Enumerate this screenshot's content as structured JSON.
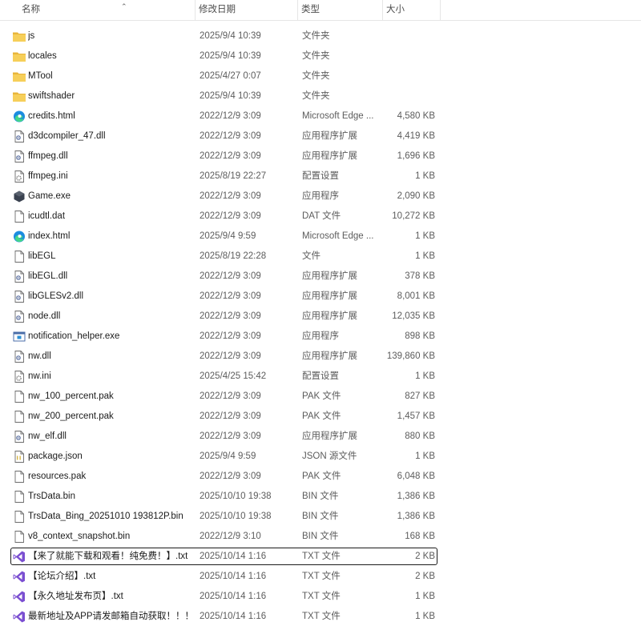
{
  "columns": {
    "name": "名称",
    "modified": "修改日期",
    "type": "类型",
    "size": "大小"
  },
  "files": [
    {
      "name": "js",
      "date": "2025/9/4 10:39",
      "type": "文件夹",
      "size": "",
      "icon": "folder-icon"
    },
    {
      "name": "locales",
      "date": "2025/9/4 10:39",
      "type": "文件夹",
      "size": "",
      "icon": "folder-icon"
    },
    {
      "name": "MTool",
      "date": "2025/4/27 0:07",
      "type": "文件夹",
      "size": "",
      "icon": "folder-icon"
    },
    {
      "name": "swiftshader",
      "date": "2025/9/4 10:39",
      "type": "文件夹",
      "size": "",
      "icon": "folder-icon"
    },
    {
      "name": "credits.html",
      "date": "2022/12/9 3:09",
      "type": "Microsoft Edge ...",
      "size": "4,580 KB",
      "icon": "edge-icon"
    },
    {
      "name": "d3dcompiler_47.dll",
      "date": "2022/12/9 3:09",
      "type": "应用程序扩展",
      "size": "4,419 KB",
      "icon": "dll-icon"
    },
    {
      "name": "ffmpeg.dll",
      "date": "2022/12/9 3:09",
      "type": "应用程序扩展",
      "size": "1,696 KB",
      "icon": "dll-icon"
    },
    {
      "name": "ffmpeg.ini",
      "date": "2025/8/19 22:27",
      "type": "配置设置",
      "size": "1 KB",
      "icon": "ini-icon"
    },
    {
      "name": "Game.exe",
      "date": "2022/12/9 3:09",
      "type": "应用程序",
      "size": "2,090 KB",
      "icon": "game-exe-icon"
    },
    {
      "name": "icudtl.dat",
      "date": "2022/12/9 3:09",
      "type": "DAT 文件",
      "size": "10,272 KB",
      "icon": "file-icon"
    },
    {
      "name": "index.html",
      "date": "2025/9/4 9:59",
      "type": "Microsoft Edge ...",
      "size": "1 KB",
      "icon": "edge-icon"
    },
    {
      "name": "libEGL",
      "date": "2025/8/19 22:28",
      "type": "文件",
      "size": "1 KB",
      "icon": "file-icon"
    },
    {
      "name": "libEGL.dll",
      "date": "2022/12/9 3:09",
      "type": "应用程序扩展",
      "size": "378 KB",
      "icon": "dll-icon"
    },
    {
      "name": "libGLESv2.dll",
      "date": "2022/12/9 3:09",
      "type": "应用程序扩展",
      "size": "8,001 KB",
      "icon": "dll-icon"
    },
    {
      "name": "node.dll",
      "date": "2022/12/9 3:09",
      "type": "应用程序扩展",
      "size": "12,035 KB",
      "icon": "dll-icon"
    },
    {
      "name": "notification_helper.exe",
      "date": "2022/12/9 3:09",
      "type": "应用程序",
      "size": "898 KB",
      "icon": "exe-icon"
    },
    {
      "name": "nw.dll",
      "date": "2022/12/9 3:09",
      "type": "应用程序扩展",
      "size": "139,860 KB",
      "icon": "dll-icon"
    },
    {
      "name": "nw.ini",
      "date": "2025/4/25 15:42",
      "type": "配置设置",
      "size": "1 KB",
      "icon": "ini-icon"
    },
    {
      "name": "nw_100_percent.pak",
      "date": "2022/12/9 3:09",
      "type": "PAK 文件",
      "size": "827 KB",
      "icon": "file-icon"
    },
    {
      "name": "nw_200_percent.pak",
      "date": "2022/12/9 3:09",
      "type": "PAK 文件",
      "size": "1,457 KB",
      "icon": "file-icon"
    },
    {
      "name": "nw_elf.dll",
      "date": "2022/12/9 3:09",
      "type": "应用程序扩展",
      "size": "880 KB",
      "icon": "dll-icon"
    },
    {
      "name": "package.json",
      "date": "2025/9/4 9:59",
      "type": "JSON 源文件",
      "size": "1 KB",
      "icon": "json-icon"
    },
    {
      "name": "resources.pak",
      "date": "2022/12/9 3:09",
      "type": "PAK 文件",
      "size": "6,048 KB",
      "icon": "file-icon"
    },
    {
      "name": "TrsData.bin",
      "date": "2025/10/10 19:38",
      "type": "BIN 文件",
      "size": "1,386 KB",
      "icon": "file-icon"
    },
    {
      "name": "TrsData_Bing_20251010 193812P.bin",
      "date": "2025/10/10 19:38",
      "type": "BIN 文件",
      "size": "1,386 KB",
      "icon": "file-icon"
    },
    {
      "name": "v8_context_snapshot.bin",
      "date": "2022/12/9 3:10",
      "type": "BIN 文件",
      "size": "168 KB",
      "icon": "file-icon"
    },
    {
      "name": "【来了就能下载和观看！纯免费！】.txt",
      "date": "2025/10/14 1:16",
      "type": "TXT 文件",
      "size": "2 KB",
      "icon": "visual-studio-icon",
      "selected": true
    },
    {
      "name": "【论坛介绍】.txt",
      "date": "2025/10/14 1:16",
      "type": "TXT 文件",
      "size": "2 KB",
      "icon": "visual-studio-icon"
    },
    {
      "name": "【永久地址发布页】.txt",
      "date": "2025/10/14 1:16",
      "type": "TXT 文件",
      "size": "1 KB",
      "icon": "visual-studio-icon"
    },
    {
      "name": "最新地址及APP请发邮箱自动获取！！！....",
      "date": "2025/10/14 1:16",
      "type": "TXT 文件",
      "size": "1 KB",
      "icon": "visual-studio-icon"
    }
  ],
  "colors": {
    "folder": "#f3c74a",
    "edge": "#1c8ce0",
    "visual_studio": "#7b4fd1",
    "selection_border": "#1b1b1b"
  }
}
